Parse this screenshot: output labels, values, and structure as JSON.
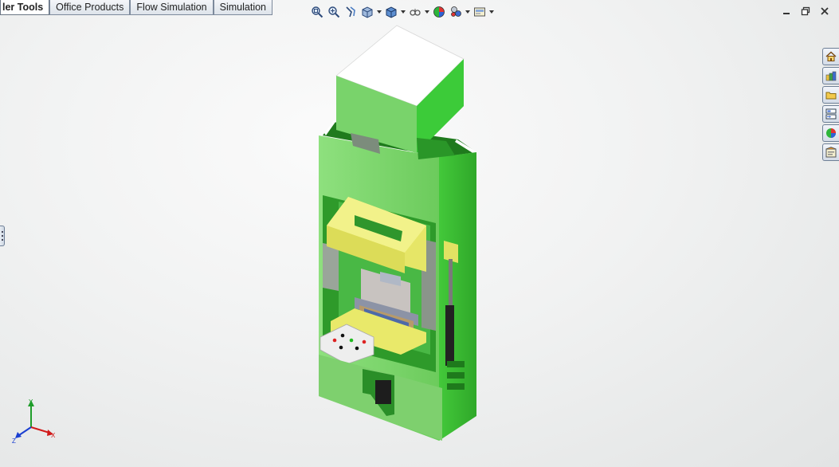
{
  "tabs": [
    {
      "label": "ler Tools",
      "active": true
    },
    {
      "label": "Office Products",
      "active": false
    },
    {
      "label": "Flow Simulation",
      "active": false
    },
    {
      "label": "Simulation",
      "active": false
    }
  ],
  "hud_toolbar": [
    {
      "icon": "zoom-to-fit-icon"
    },
    {
      "icon": "zoom-to-area-icon"
    },
    {
      "icon": "previous-view-icon"
    },
    {
      "icon": "section-view-icon"
    },
    {
      "icon": "view-orientation-icon",
      "dropdown": true
    },
    {
      "icon": "display-style-icon",
      "dropdown": true
    },
    {
      "icon": "hide-show-items-icon",
      "dropdown": true
    },
    {
      "icon": "edit-appearance-icon"
    },
    {
      "icon": "apply-scene-icon",
      "dropdown": true
    },
    {
      "icon": "view-settings-icon",
      "dropdown": true
    }
  ],
  "window_controls": [
    "minimize-icon",
    "restore-icon",
    "close-icon"
  ],
  "task_pane": [
    {
      "icon": "home-icon",
      "name": "solidworks-resources"
    },
    {
      "icon": "design-library-icon",
      "name": "design-library"
    },
    {
      "icon": "folder-icon",
      "name": "file-explorer"
    },
    {
      "icon": "view-palette-icon",
      "name": "view-palette"
    },
    {
      "icon": "appearances-icon",
      "name": "appearances-scenes"
    },
    {
      "icon": "custom-properties-icon",
      "name": "custom-properties"
    }
  ],
  "triad": {
    "x": "X",
    "y": "Y",
    "z": "Z"
  },
  "colors": {
    "frame_green": "#7ad26a",
    "frame_bright": "#3ccf3c",
    "ram_yellow": "#ecec6a",
    "cylinder_white": "#ffffff",
    "axis_x": "#d11a1a",
    "axis_y": "#1f9d2a",
    "axis_z": "#1a3fd1"
  }
}
